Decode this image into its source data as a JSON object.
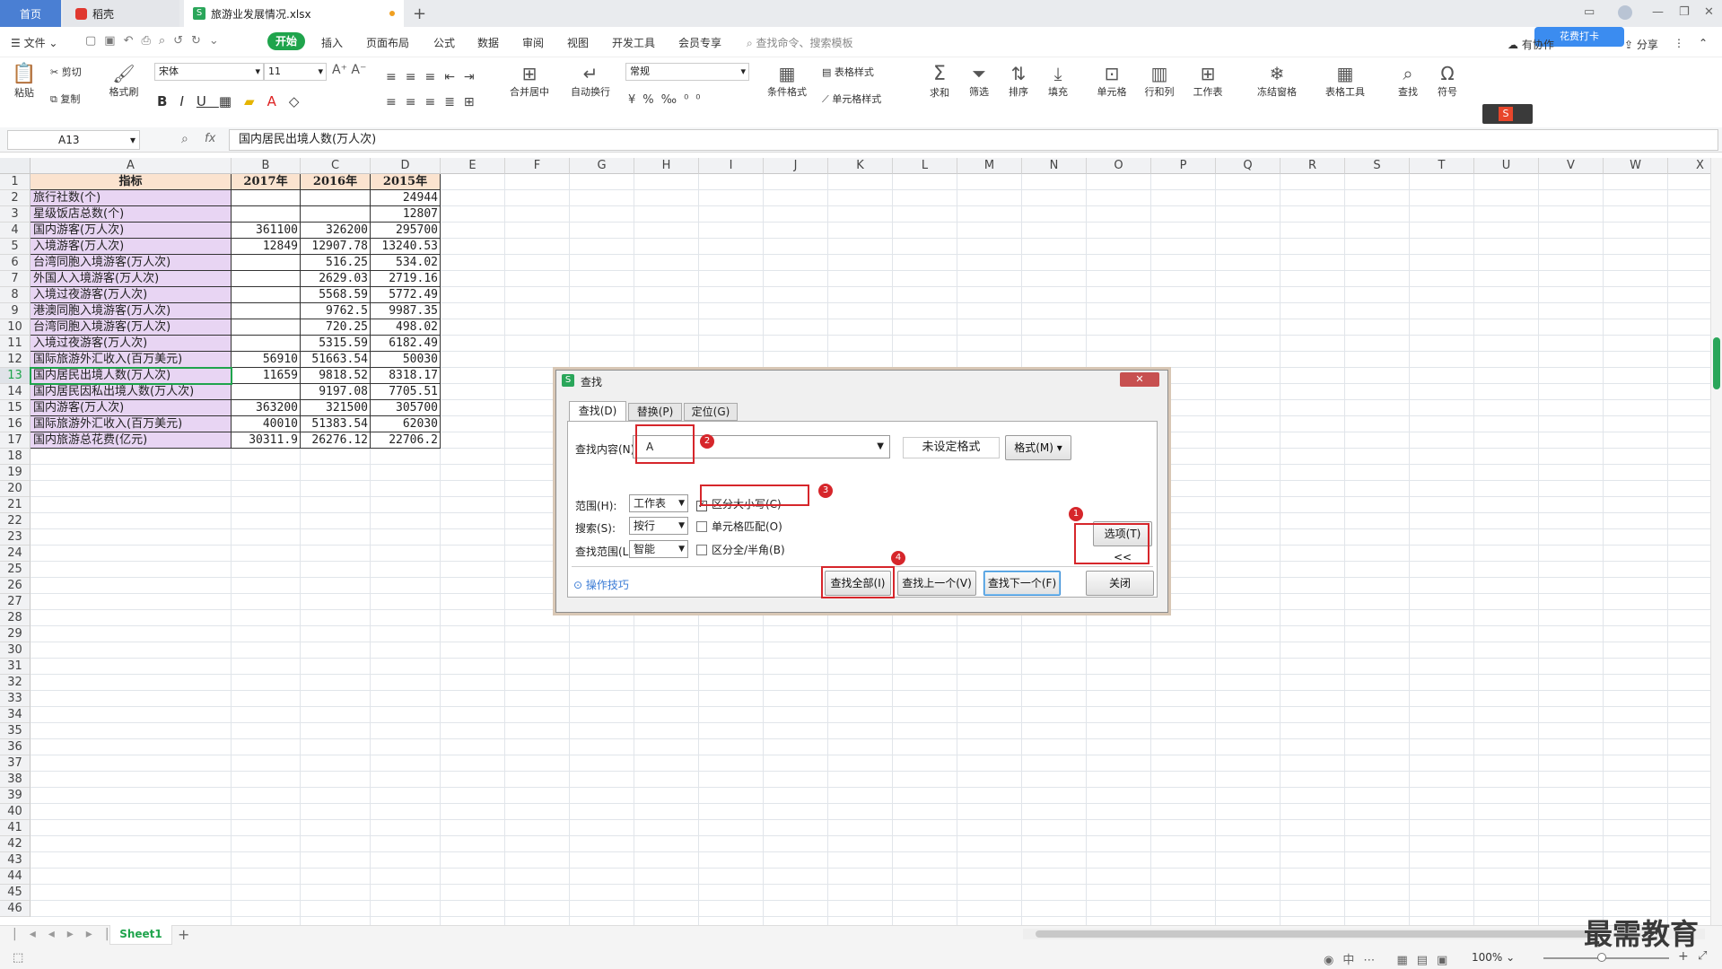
{
  "tabs": {
    "home": "首页",
    "shell": "稻壳",
    "file": "旅游业发展情况.xlsx",
    "add": "+"
  },
  "menu": {
    "file": "文件",
    "items": [
      "开始",
      "插入",
      "页面布局",
      "公式",
      "数据",
      "审阅",
      "视图",
      "开发工具",
      "会员专享"
    ],
    "search_placeholder": "查找命令、搜索模板",
    "right": [
      "有协作",
      "分享"
    ],
    "promo": "花费打卡"
  },
  "ribbon": {
    "paste": "粘贴",
    "cut": "剪切",
    "copy": "复制",
    "format_painter": "格式刷",
    "font_name": "宋体",
    "font_size": "11",
    "merge": "合并居中",
    "wrap": "自动换行",
    "number_format": "常规",
    "cond_format": "条件格式",
    "table_style": "表格样式",
    "cell_style": "单元格样式",
    "sum": "求和",
    "filter": "筛选",
    "sort": "排序",
    "fill": "填充",
    "cell": "单元格",
    "rowcol": "行和列",
    "sheet": "工作表",
    "freeze": "冻结窗格",
    "table_tools": "表格工具",
    "find": "查找",
    "symbol": "符号"
  },
  "formula_bar": {
    "cell_ref": "A13",
    "fx": "fx",
    "content": "国内居民出境人数(万人次)"
  },
  "columns": [
    "A",
    "B",
    "C",
    "D",
    "E",
    "F",
    "G",
    "H",
    "I",
    "J",
    "K",
    "L",
    "M",
    "N",
    "O",
    "P",
    "Q",
    "R",
    "S",
    "T",
    "U",
    "V",
    "W",
    "X"
  ],
  "header_row": [
    "指标",
    "2017年",
    "2016年",
    "2015年"
  ],
  "rows": [
    [
      "旅行社数(个)",
      "",
      "",
      "24944"
    ],
    [
      "星级饭店总数(个)",
      "",
      "",
      "12807"
    ],
    [
      "国内游客(万人次)",
      "361100",
      "326200",
      "295700"
    ],
    [
      "入境游客(万人次)",
      "12849",
      "12907.78",
      "13240.53"
    ],
    [
      "台湾同胞入境游客(万人次)",
      "",
      "516.25",
      "534.02"
    ],
    [
      "外国人入境游客(万人次)",
      "",
      "2629.03",
      "2719.16"
    ],
    [
      "入境过夜游客(万人次)",
      "",
      "5568.59",
      "5772.49"
    ],
    [
      "港澳同胞入境游客(万人次)",
      "",
      "9762.5",
      "9987.35"
    ],
    [
      "台湾同胞入境游客(万人次)",
      "",
      "720.25",
      "498.02"
    ],
    [
      "入境过夜游客(万人次)",
      "",
      "5315.59",
      "6182.49"
    ],
    [
      "国际旅游外汇收入(百万美元)",
      "56910",
      "51663.54",
      "50030"
    ],
    [
      "国内居民出境人数(万人次)",
      "11659",
      "9818.52",
      "8318.17"
    ],
    [
      "国内居民因私出境人数(万人次)",
      "",
      "9197.08",
      "7705.51"
    ],
    [
      "国内游客(万人次)",
      "363200",
      "321500",
      "305700"
    ],
    [
      "国际旅游外汇收入(百万美元)",
      "40010",
      "51383.54",
      "62030"
    ],
    [
      "国内旅游总花费(亿元)",
      "30311.9",
      "26276.12",
      "22706.2"
    ]
  ],
  "sheet_tab": "Sheet1",
  "zoom": "100%",
  "watermark": "最需教育",
  "dialog": {
    "title": "查找",
    "tabs": [
      "查找(D)",
      "替换(P)",
      "定位(G)"
    ],
    "find_label": "查找内容(N):",
    "find_value": "A",
    "no_format": "未设定格式",
    "format_btn": "格式(M)",
    "scope_label": "范围(H):",
    "scope_value": "工作表",
    "search_label": "搜索(S):",
    "search_value": "按行",
    "lookin_label": "查找范围(L):",
    "lookin_value": "智能",
    "match_case": "区分大小写(C)",
    "whole_cell": "单元格匹配(O)",
    "full_half": "区分全/半角(B)",
    "options_btn": "选项(T) <<",
    "tips": "操作技巧",
    "find_all": "查找全部(I)",
    "find_prev": "查找上一个(V)",
    "find_next": "查找下一个(F)",
    "close": "关闭",
    "badges": [
      "1",
      "2",
      "3",
      "4"
    ]
  }
}
